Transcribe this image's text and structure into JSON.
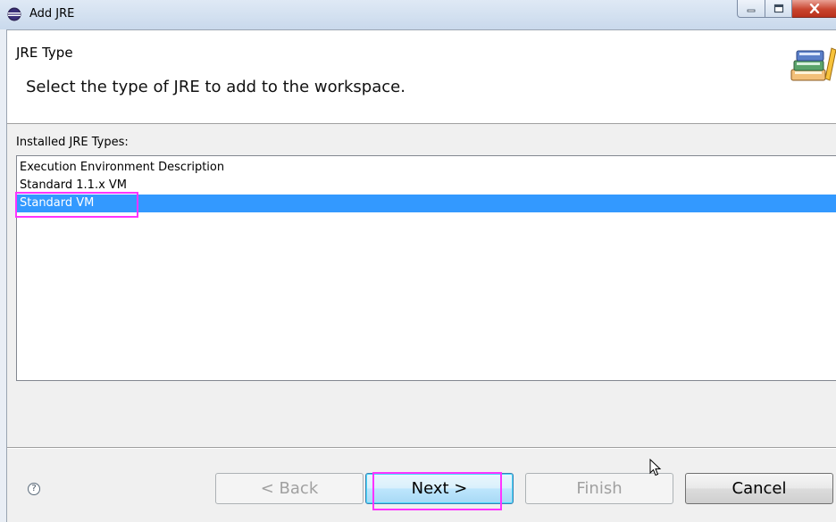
{
  "window": {
    "title": "Add JRE",
    "controls": [
      "minimize",
      "maximize",
      "close"
    ]
  },
  "header": {
    "title": "JRE Type",
    "description": "Select the type of JRE to add to the workspace."
  },
  "list": {
    "label": "Installed JRE Types:",
    "items": [
      {
        "label": "Execution Environment Description",
        "selected": false
      },
      {
        "label": "Standard 1.1.x VM",
        "selected": false
      },
      {
        "label": "Standard VM",
        "selected": true
      }
    ]
  },
  "buttons": {
    "help": "?",
    "back": "< Back",
    "next": "Next >",
    "finish": "Finish",
    "cancel": "Cancel"
  },
  "colors": {
    "selection": "#3399ff",
    "highlight_annotation": "#ff33ff"
  }
}
